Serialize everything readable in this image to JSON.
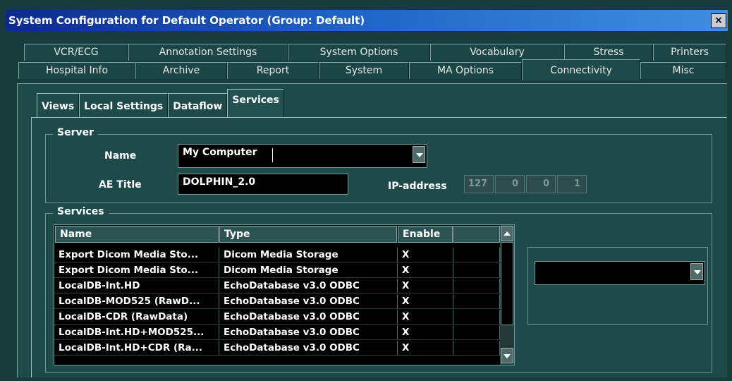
{
  "window": {
    "title": "System Configuration for Default Operator (Group: Default)",
    "close_label": "×"
  },
  "tabs_row1": [
    "VCR/ECG",
    "Annotation Settings",
    "System Options",
    "Vocabulary",
    "Stress",
    "Printers"
  ],
  "tabs_row2": [
    "Hospital Info",
    "Archive",
    "Report",
    "System",
    "MA Options",
    "Connectivity",
    "Misc"
  ],
  "active_tab": "Connectivity",
  "inner_tabs": [
    "Views",
    "Local Settings",
    "Dataflow",
    "Services"
  ],
  "active_inner_tab": "Services",
  "server": {
    "group_title": "Server",
    "name_label": "Name",
    "name_value": "My Computer",
    "ae_title_label": "AE Title",
    "ae_title_value": "DOLPHIN_2.0",
    "ip_label": "IP-address",
    "ip": [
      "127",
      "0",
      "0",
      "1"
    ]
  },
  "services": {
    "group_title": "Services",
    "columns": [
      "Name",
      "Type",
      "Enable"
    ],
    "rows": [
      {
        "name": "Export Dicom Media Sto...",
        "type": "Dicom Media Storage",
        "enable": "X"
      },
      {
        "name": "Export Dicom Media Sto...",
        "type": "Dicom Media Storage",
        "enable": "X"
      },
      {
        "name": "LocalDB-Int.HD",
        "type": "EchoDatabase v3.0 ODBC",
        "enable": "X"
      },
      {
        "name": "LocalDB-MOD525 (RawD...",
        "type": "EchoDatabase v3.0 ODBC",
        "enable": "X"
      },
      {
        "name": "LocalDB-CDR (RawData)",
        "type": "EchoDatabase v3.0 ODBC",
        "enable": "X"
      },
      {
        "name": "LocalDB-Int.HD+MOD525...",
        "type": "EchoDatabase v3.0 ODBC",
        "enable": "X"
      },
      {
        "name": "LocalDB-Int.HD+CDR (Ra...",
        "type": "EchoDatabase v3.0 ODBC",
        "enable": "X"
      }
    ],
    "side_combo_value": ""
  },
  "colors": {
    "background": "#183c3c",
    "title_bar": "#0c2a8c",
    "field_bg": "#000000"
  }
}
